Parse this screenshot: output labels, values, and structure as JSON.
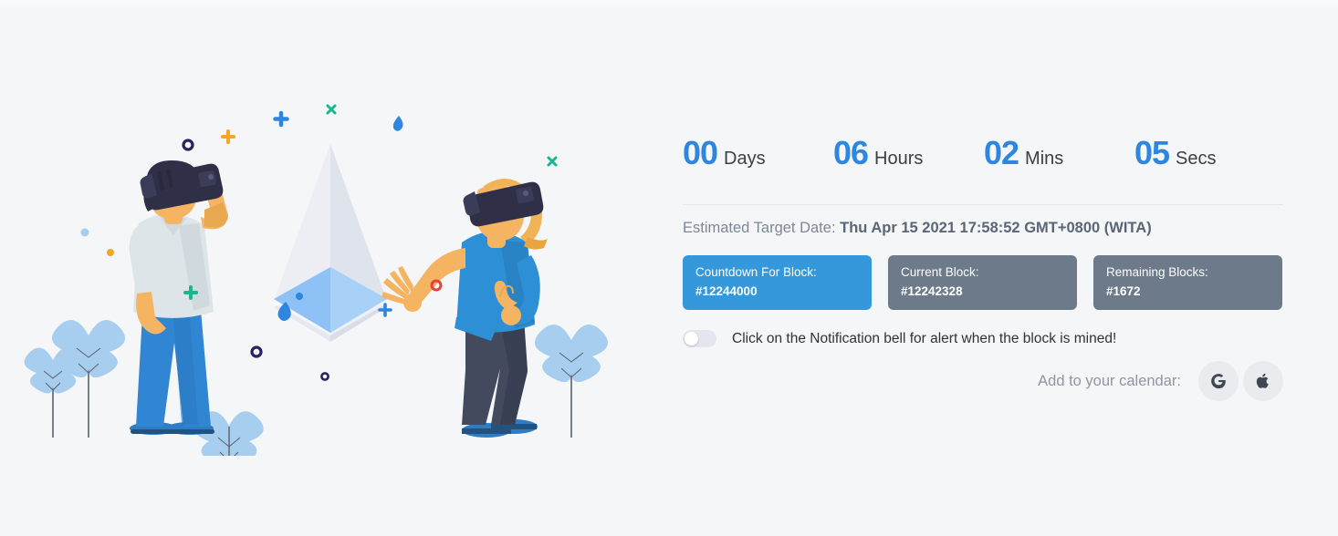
{
  "countdown": {
    "units": [
      {
        "value": "00",
        "label": "Days"
      },
      {
        "value": "06",
        "label": "Hours"
      },
      {
        "value": "02",
        "label": "Mins"
      },
      {
        "value": "05",
        "label": "Secs"
      }
    ],
    "accent_color": "#2e86de"
  },
  "target": {
    "label": "Estimated Target Date:",
    "value": "Thu Apr 15 2021 17:58:52 GMT+0800 (WITA)"
  },
  "cards": [
    {
      "title": "Countdown For Block:",
      "value": "#12244000",
      "color": "#3498db",
      "style": "blue"
    },
    {
      "title": "Current Block:",
      "value": "#12242328",
      "color": "#6c7a89",
      "style": "gray"
    },
    {
      "title": "Remaining Blocks:",
      "value": "#1672",
      "color": "#6c7a89",
      "style": "gray"
    }
  ],
  "notification": {
    "toggle_state": "off",
    "text": "Click on the Notification bell for alert when the block is mined!"
  },
  "calendar": {
    "label": "Add to your calendar:",
    "buttons": [
      {
        "name": "google",
        "glyph": "G"
      },
      {
        "name": "apple",
        "glyph": "apple-logo"
      }
    ]
  },
  "illustration": {
    "alt": "Two people wearing VR headsets beside a large Ethereum diamond logo with blue leaves and scattered dots",
    "colors": {
      "background": "#f5f6f8",
      "eth_light": "#eceef4",
      "eth_mid": "#dfe3ec",
      "eth_blue": "#8ec1f5",
      "eth_blue_dark": "#74b3f2",
      "leaf": "#a8ceef",
      "skin": "#f5b461",
      "shirt_light": "#dde5e8",
      "jeans": "#3086d2",
      "shirt_blue": "#2d8fd5",
      "pants_dark": "#434a5e",
      "headset": "#2f3048",
      "hair_blonde": "#f0b357",
      "navy": "#2b2160",
      "teal": "#17b890",
      "orange": "#f5a623",
      "red": "#e8413a",
      "blue_dot": "#2e86de"
    }
  }
}
